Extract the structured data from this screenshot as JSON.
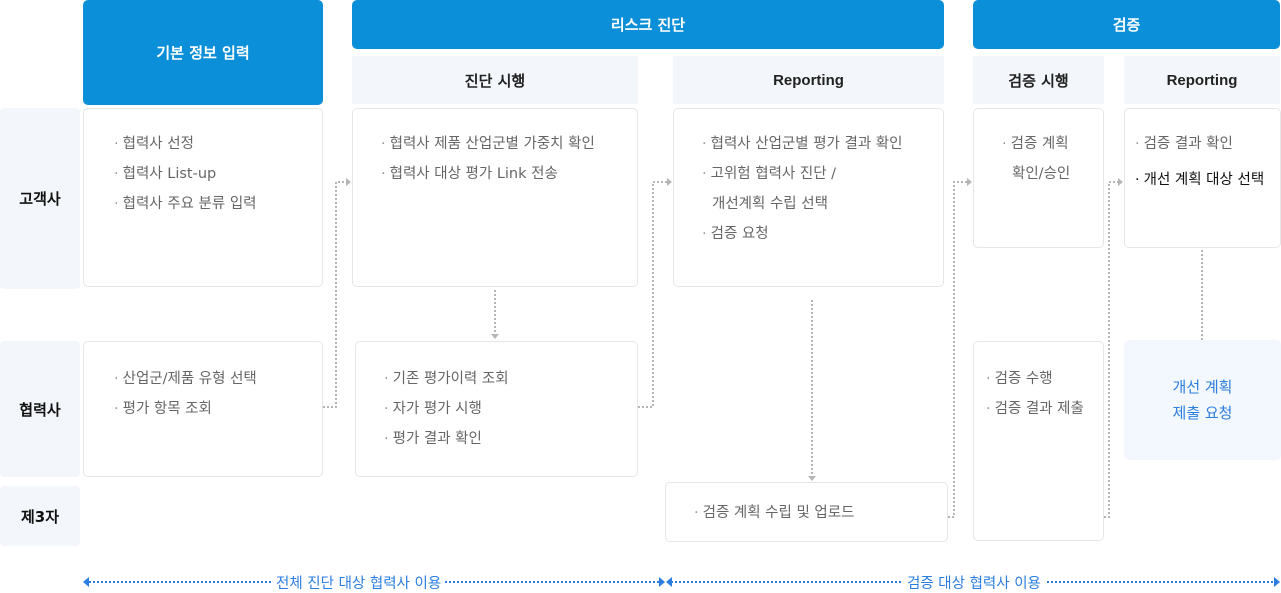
{
  "phases": {
    "basic_info": "기본 정보 입력",
    "risk_diagnosis": "리스크 진단",
    "verification": "검증"
  },
  "subphases": {
    "diagnosis_run": "진단 시행",
    "risk_reporting": "Reporting",
    "verification_run": "검증 시행",
    "verification_reporting": "Reporting"
  },
  "lanes": {
    "customer": "고객사",
    "partner": "협력사",
    "third_party": "제3자"
  },
  "boxes": {
    "customer_basic": [
      "협력사 선정",
      "협력사 List-up",
      "협력사 주요 분류 입력"
    ],
    "customer_diagnosis": [
      "협력사 제품 산업군별 가중치 확인",
      "협력사 대상 평가 Link 전송"
    ],
    "customer_reporting": [
      "협력사 산업군별 평가 결과 확인",
      "고위험 협력사 진단 /",
      "개선계획 수립 선택",
      "검증 요청"
    ],
    "customer_verification": [
      "검증 계획",
      "확인/승인"
    ],
    "customer_verif_reporting": [
      "검증 결과 확인",
      "개선 계획 대상 선택"
    ],
    "partner_basic": [
      "산업군/제품 유형 선택",
      "평가 항목 조회"
    ],
    "partner_diagnosis": [
      "기존 평가이력 조회",
      "자가 평가 시행",
      "평가 결과 확인"
    ],
    "partner_verification": [
      "검증 수행",
      "검증 결과 제출"
    ],
    "partner_improvement": [
      "개선 계획",
      "제출 요청"
    ],
    "third_party_plan": [
      "검증 계획 수립 및 업로드"
    ]
  },
  "ranges": {
    "all_partners": "전체 진단 대상 협력사 이용",
    "verified_partners": "검증 대상 협력사 이용"
  },
  "colors": {
    "primary": "#0a8fd8",
    "accent_text": "#2b7de0",
    "lane_bg": "#f3f7fc",
    "connector": "#b5b5b5"
  }
}
